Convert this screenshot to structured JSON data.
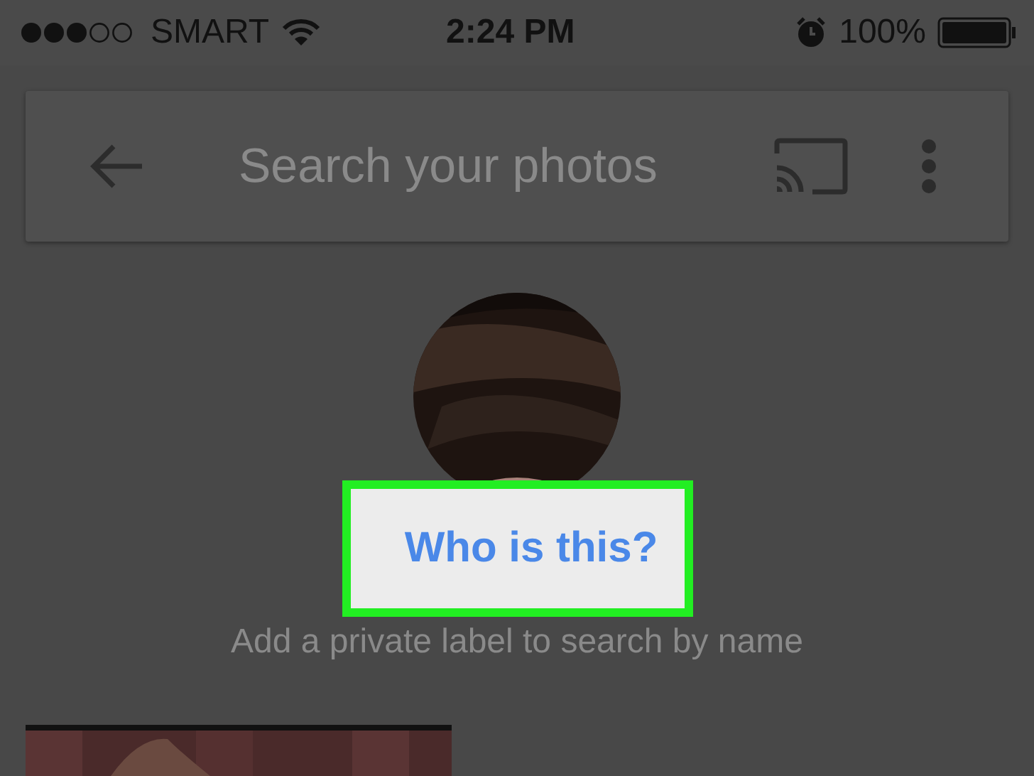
{
  "status_bar": {
    "carrier": "SMART",
    "time": "2:24 PM",
    "battery": "100%"
  },
  "search": {
    "placeholder": "Search your photos"
  },
  "face_prompt": {
    "button": "Who is this?",
    "hint": "Add a private label to search by name"
  }
}
